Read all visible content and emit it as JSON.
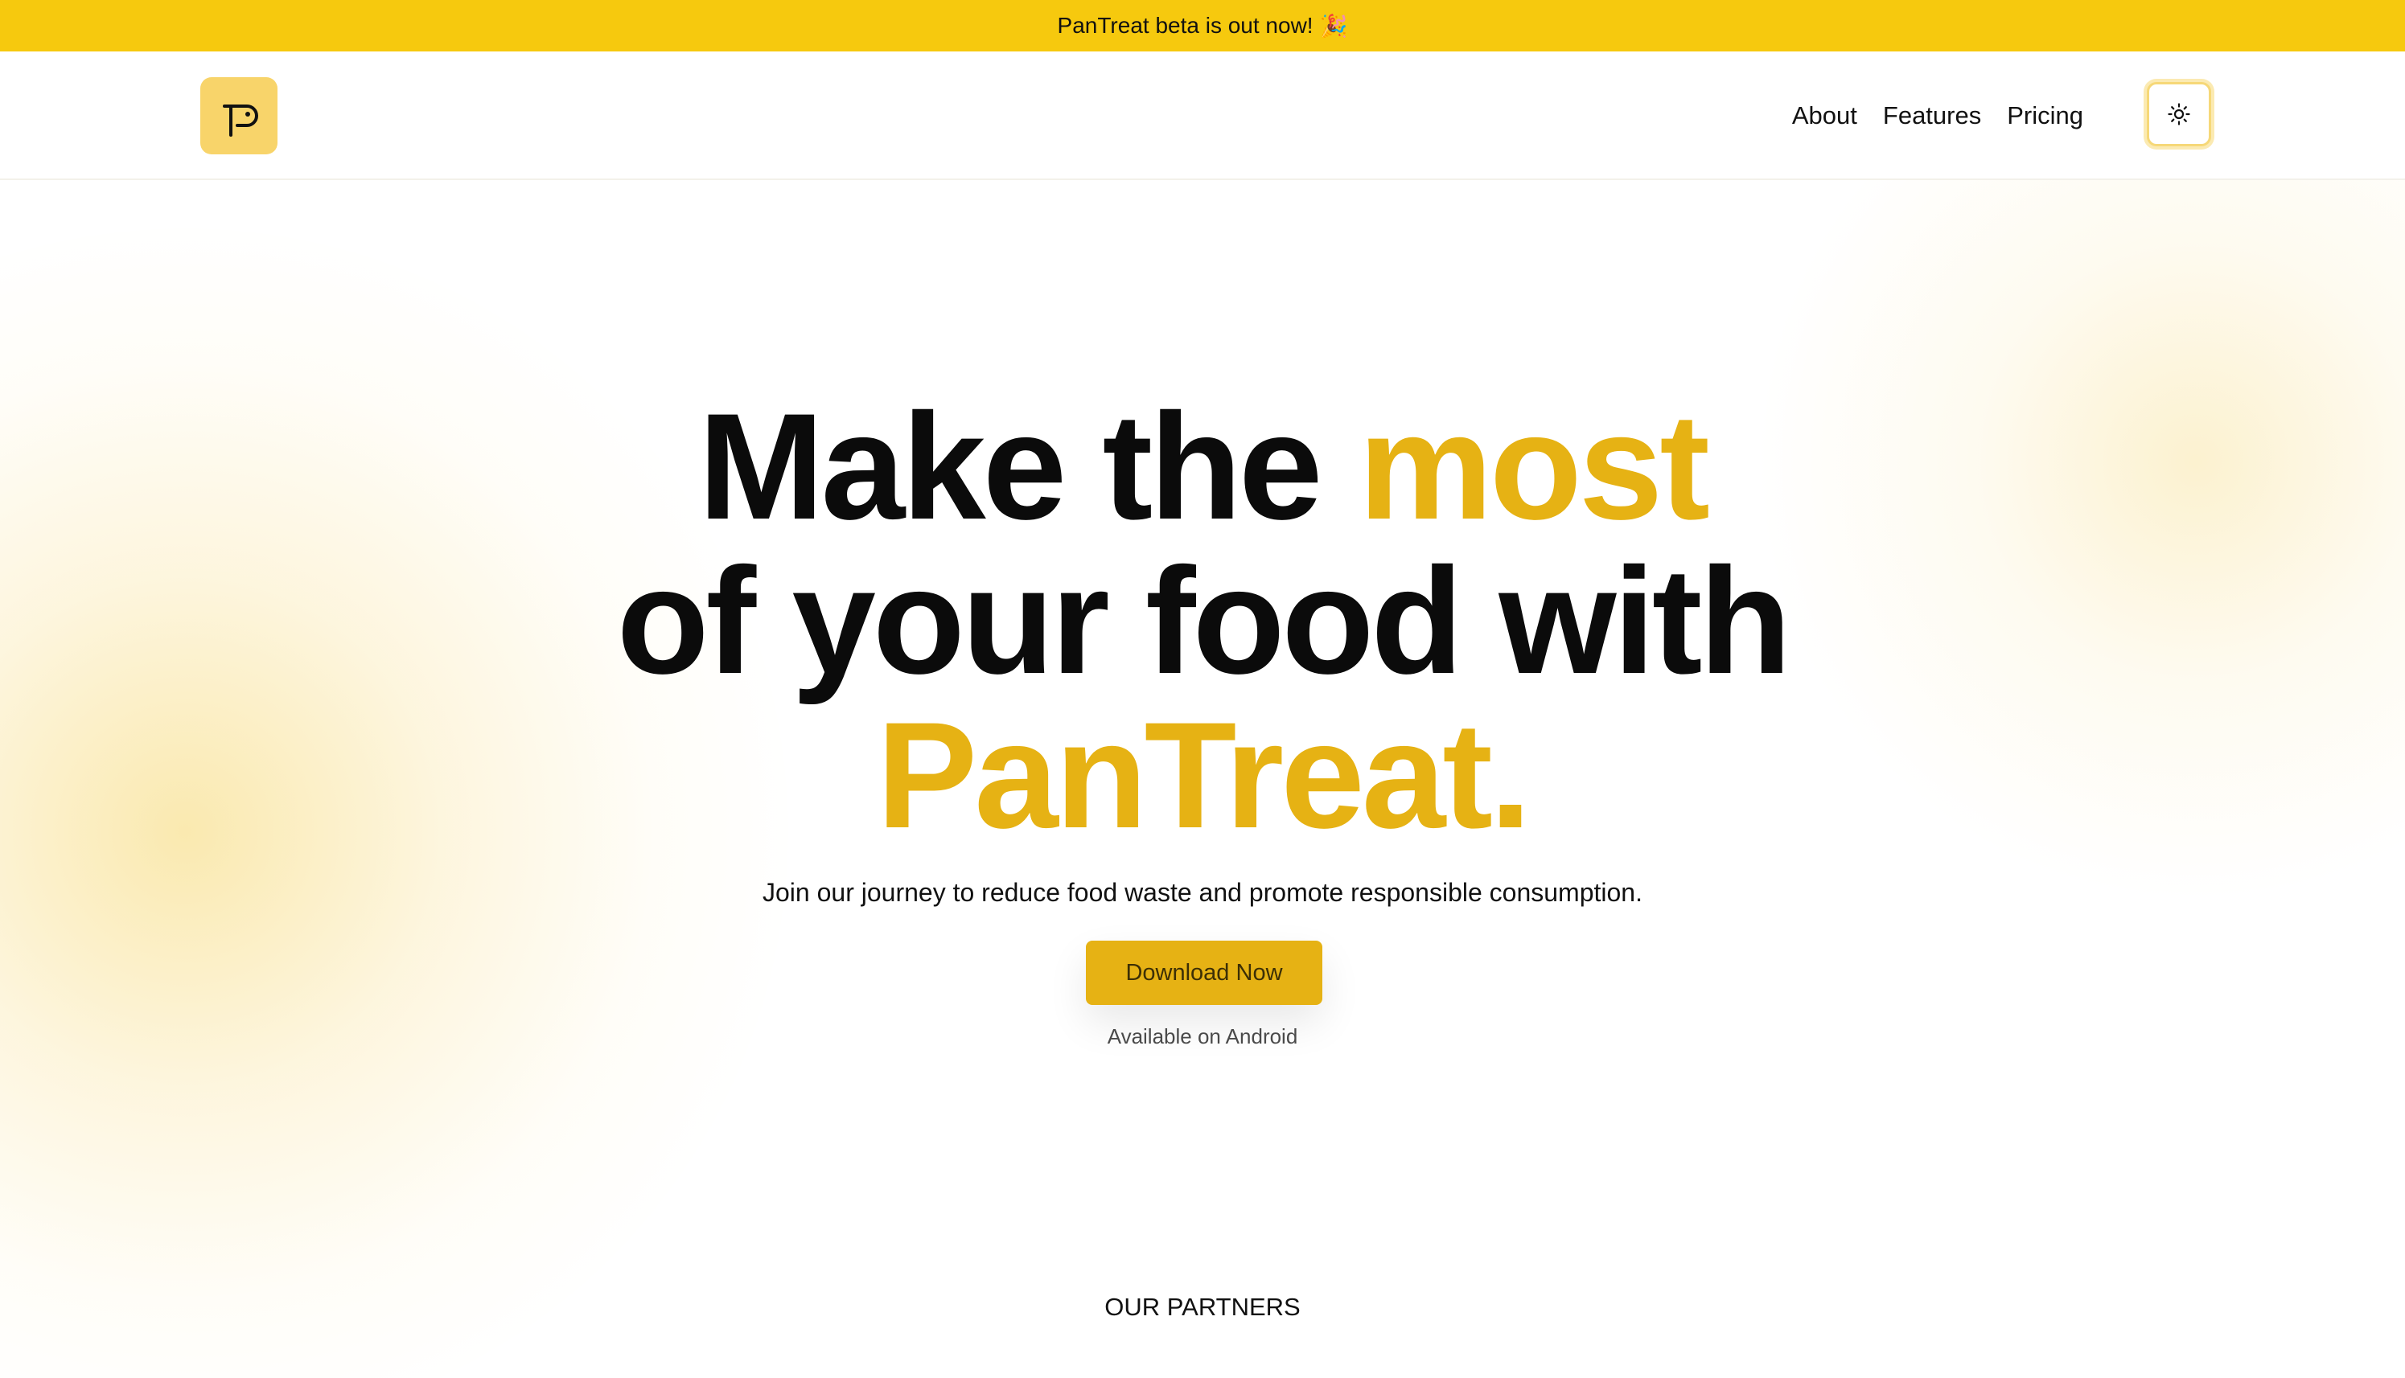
{
  "banner": {
    "text": "PanTreat beta is out now!",
    "emoji": "🎉"
  },
  "nav": {
    "logo_icon": "pantreat-logo-icon",
    "links": [
      "About",
      "Features",
      "Pricing"
    ],
    "theme_toggle_icon": "sun-icon"
  },
  "hero": {
    "headline_part1": "Make the ",
    "headline_accent1": "most",
    "headline_part2": "of your food with",
    "headline_accent2": "PanTreat.",
    "subtitle": "Join our journey to reduce food waste and promote responsible consumption.",
    "cta_label": "Download Now",
    "availability": "Available on Android"
  },
  "partners": {
    "heading": "OUR PARTNERS"
  },
  "colors": {
    "banner": "#f6c90e",
    "accent": "#e6b214",
    "logo_bg": "#f8d46a",
    "text": "#0b0b0b"
  }
}
